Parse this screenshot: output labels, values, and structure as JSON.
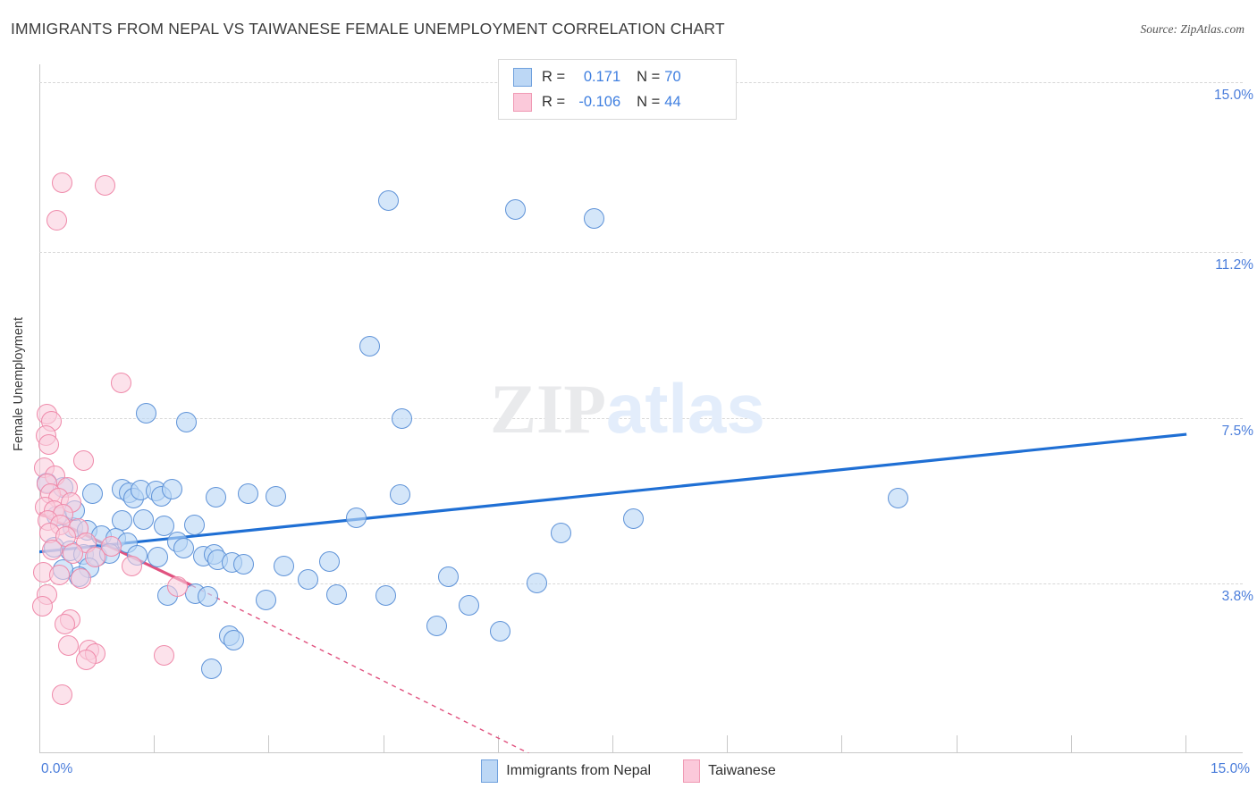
{
  "title": "IMMIGRANTS FROM NEPAL VS TAIWANESE FEMALE UNEMPLOYMENT CORRELATION CHART",
  "source": "Source: ZipAtlas.com",
  "watermark": {
    "part1": "ZIP",
    "part2": "atlas"
  },
  "legend_box": {
    "rows": [
      {
        "series": "Immigrants from Nepal",
        "r_label": "R =",
        "r_value": "0.171",
        "n_label": "N =",
        "n_value": "70",
        "color": "#bcd7f5"
      },
      {
        "series": "Taiwanese",
        "r_label": "R =",
        "r_value": "-0.106",
        "n_label": "N =",
        "n_value": "44",
        "color": "#fbc9da"
      }
    ]
  },
  "bottom_legend": [
    {
      "label": "Immigrants from Nepal",
      "color": "#bcd7f5"
    },
    {
      "label": "Taiwanese",
      "color": "#fbc9da"
    }
  ],
  "chart_data": {
    "type": "scatter",
    "title": "IMMIGRANTS FROM NEPAL VS TAIWANESE FEMALE UNEMPLOYMENT CORRELATION CHART",
    "xlabel": "Immigrants from Nepal",
    "ylabel": "Female Unemployment",
    "xlim": [
      0.0,
      15.0
    ],
    "ylim": [
      0.0,
      15.4
    ],
    "x_tick_labels": [
      "0.0%",
      "15.0%"
    ],
    "y_tick_labels": [
      "15.0%",
      "11.2%",
      "7.5%",
      "3.8%"
    ],
    "y_tick_values": [
      15.0,
      11.2,
      7.5,
      3.8
    ],
    "grid": true,
    "legend_position": "bottom-center",
    "series": [
      {
        "name": "Immigrants from Nepal",
        "color": "#bcd7f5",
        "edge_color": "#5f93d8",
        "r": 0.171,
        "n": 70,
        "trend": {
          "style": "solid",
          "color": "#1f6fd4",
          "x0": 0.0,
          "y0": 4.5,
          "x1": 14.3,
          "y1": 7.13
        },
        "points": [
          [
            4.35,
            12.36
          ],
          [
            5.93,
            12.16
          ],
          [
            6.92,
            11.95
          ],
          [
            4.12,
            9.09
          ],
          [
            1.33,
            7.6
          ],
          [
            1.83,
            7.4
          ],
          [
            4.52,
            7.49
          ],
          [
            0.1,
            6.05
          ],
          [
            0.3,
            5.95
          ],
          [
            0.66,
            5.8
          ],
          [
            1.03,
            5.9
          ],
          [
            1.12,
            5.82
          ],
          [
            1.18,
            5.71
          ],
          [
            1.27,
            5.88
          ],
          [
            1.45,
            5.86
          ],
          [
            1.52,
            5.74
          ],
          [
            1.66,
            5.9
          ],
          [
            2.2,
            5.72
          ],
          [
            2.6,
            5.8
          ],
          [
            2.95,
            5.74
          ],
          [
            4.5,
            5.78
          ],
          [
            10.7,
            5.7
          ],
          [
            1.03,
            5.2
          ],
          [
            1.3,
            5.22
          ],
          [
            1.55,
            5.08
          ],
          [
            1.93,
            5.1
          ],
          [
            3.95,
            5.26
          ],
          [
            6.5,
            4.92
          ],
          [
            7.4,
            5.25
          ],
          [
            0.22,
            5.3
          ],
          [
            0.42,
            5.05
          ],
          [
            0.6,
            4.98
          ],
          [
            0.78,
            4.86
          ],
          [
            0.95,
            4.8
          ],
          [
            1.1,
            4.7
          ],
          [
            1.72,
            4.72
          ],
          [
            0.18,
            4.6
          ],
          [
            0.38,
            4.52
          ],
          [
            0.55,
            4.44
          ],
          [
            0.72,
            4.4
          ],
          [
            0.88,
            4.46
          ],
          [
            1.22,
            4.42
          ],
          [
            1.48,
            4.38
          ],
          [
            1.8,
            4.58
          ],
          [
            2.05,
            4.4
          ],
          [
            2.18,
            4.45
          ],
          [
            2.22,
            4.32
          ],
          [
            2.4,
            4.26
          ],
          [
            2.55,
            4.22
          ],
          [
            3.05,
            4.18
          ],
          [
            3.62,
            4.28
          ],
          [
            3.35,
            3.88
          ],
          [
            5.1,
            3.95
          ],
          [
            6.2,
            3.8
          ],
          [
            1.6,
            3.52
          ],
          [
            1.95,
            3.56
          ],
          [
            2.1,
            3.5
          ],
          [
            2.82,
            3.42
          ],
          [
            3.7,
            3.55
          ],
          [
            4.32,
            3.52
          ],
          [
            5.35,
            3.3
          ],
          [
            4.95,
            2.85
          ],
          [
            5.75,
            2.72
          ],
          [
            2.37,
            2.62
          ],
          [
            2.42,
            2.52
          ],
          [
            0.62,
            4.15
          ],
          [
            0.5,
            3.95
          ],
          [
            0.3,
            4.1
          ],
          [
            2.15,
            1.88
          ],
          [
            0.44,
            5.42
          ]
        ]
      },
      {
        "name": "Taiwanese",
        "color": "#fbc9da",
        "edge_color": "#ef8aaa",
        "r": -0.106,
        "n": 44,
        "trend": {
          "style": "solid-then-dashed",
          "color": "#e0527f",
          "x0": 0.0,
          "y0": 5.37,
          "x1": 1.9,
          "y1": 3.75,
          "x_dash_end": 6.1,
          "y_dash_end": 0.0
        },
        "points": [
          [
            0.28,
            12.75
          ],
          [
            0.82,
            12.7
          ],
          [
            0.22,
            11.92
          ],
          [
            1.02,
            8.28
          ],
          [
            0.1,
            7.58
          ],
          [
            0.15,
            7.42
          ],
          [
            0.08,
            7.1
          ],
          [
            0.12,
            6.9
          ],
          [
            0.55,
            6.55
          ],
          [
            0.06,
            6.38
          ],
          [
            0.2,
            6.2
          ],
          [
            0.09,
            6.02
          ],
          [
            0.35,
            5.95
          ],
          [
            0.14,
            5.8
          ],
          [
            0.24,
            5.7
          ],
          [
            0.4,
            5.6
          ],
          [
            0.07,
            5.5
          ],
          [
            0.18,
            5.42
          ],
          [
            0.3,
            5.34
          ],
          [
            0.11,
            5.2
          ],
          [
            0.26,
            5.1
          ],
          [
            0.48,
            5.02
          ],
          [
            0.13,
            4.92
          ],
          [
            0.33,
            4.84
          ],
          [
            0.58,
            4.7
          ],
          [
            0.9,
            4.62
          ],
          [
            0.16,
            4.55
          ],
          [
            0.42,
            4.46
          ],
          [
            0.7,
            4.38
          ],
          [
            1.15,
            4.18
          ],
          [
            0.05,
            4.05
          ],
          [
            0.25,
            3.98
          ],
          [
            0.52,
            3.9
          ],
          [
            1.72,
            3.72
          ],
          [
            0.09,
            3.55
          ],
          [
            0.04,
            3.28
          ],
          [
            0.38,
            2.98
          ],
          [
            0.32,
            2.88
          ],
          [
            0.36,
            2.4
          ],
          [
            0.62,
            2.3
          ],
          [
            0.7,
            2.22
          ],
          [
            0.58,
            2.08
          ],
          [
            1.55,
            2.18
          ],
          [
            0.28,
            1.3
          ]
        ]
      }
    ]
  }
}
